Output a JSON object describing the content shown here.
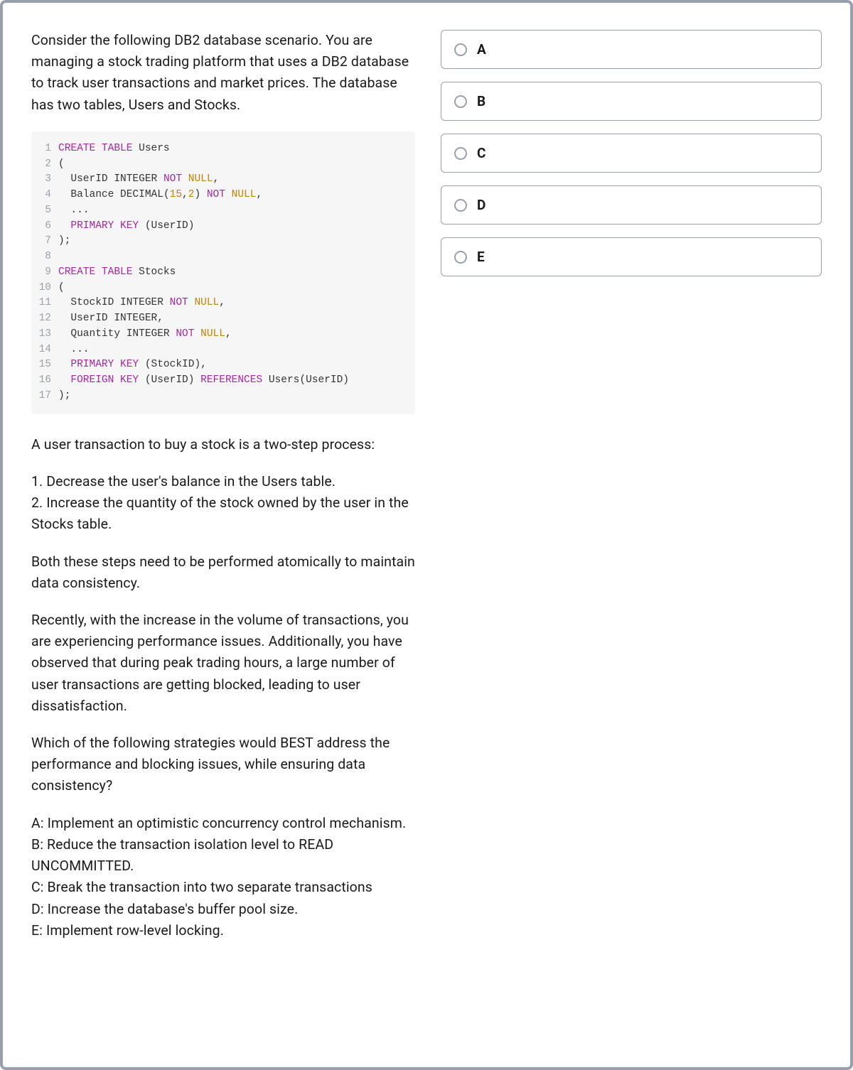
{
  "question": {
    "intro": "Consider the following DB2 database scenario. You are managing a stock trading platform that uses a DB2 database to track user transactions and market prices. The database has two tables, Users and Stocks.",
    "after_code_1": "A user transaction to buy a stock is a two-step process:",
    "steps": "1. Decrease the user's balance in the Users table.\n2. Increase the quantity of the stock owned by the user in the Stocks table.",
    "atomic": "Both these steps need to be performed atomically to maintain data consistency.",
    "problem": "Recently, with the increase in the volume of transactions, you are experiencing performance issues. Additionally, you have observed that during peak trading hours, a large number of user transactions are getting blocked, leading to user dissatisfaction.",
    "ask": "Which of the following strategies would BEST address the performance and blocking issues, while ensuring data consistency?",
    "choices_text": "A: Implement an optimistic concurrency control mechanism.\nB: Reduce the transaction isolation level to READ UNCOMMITTED.\nC: Break the transaction into two separate transactions\nD: Increase the database's buffer pool size.\nE: Implement row-level locking."
  },
  "code": {
    "lines": [
      [
        {
          "t": "CREATE TABLE",
          "c": "kw"
        },
        {
          "t": " Users",
          "c": ""
        }
      ],
      [
        {
          "t": "(",
          "c": ""
        }
      ],
      [
        {
          "t": "  UserID ",
          "c": ""
        },
        {
          "t": "INTEGER",
          "c": ""
        },
        {
          "t": " ",
          "c": ""
        },
        {
          "t": "NOT",
          "c": "kw"
        },
        {
          "t": " ",
          "c": ""
        },
        {
          "t": "NULL",
          "c": "null"
        },
        {
          "t": ",",
          "c": ""
        }
      ],
      [
        {
          "t": "  Balance ",
          "c": ""
        },
        {
          "t": "DECIMAL",
          "c": ""
        },
        {
          "t": "(",
          "c": ""
        },
        {
          "t": "15",
          "c": "num"
        },
        {
          "t": ",",
          "c": ""
        },
        {
          "t": "2",
          "c": "num"
        },
        {
          "t": ") ",
          "c": ""
        },
        {
          "t": "NOT",
          "c": "kw"
        },
        {
          "t": " ",
          "c": ""
        },
        {
          "t": "NULL",
          "c": "null"
        },
        {
          "t": ",",
          "c": ""
        }
      ],
      [
        {
          "t": "  ...",
          "c": ""
        }
      ],
      [
        {
          "t": "  ",
          "c": ""
        },
        {
          "t": "PRIMARY KEY",
          "c": "kw"
        },
        {
          "t": " (UserID)",
          "c": ""
        }
      ],
      [
        {
          "t": ");",
          "c": ""
        }
      ],
      [
        {
          "t": "",
          "c": ""
        }
      ],
      [
        {
          "t": "CREATE TABLE",
          "c": "kw"
        },
        {
          "t": " Stocks",
          "c": ""
        }
      ],
      [
        {
          "t": "(",
          "c": ""
        }
      ],
      [
        {
          "t": "  StockID ",
          "c": ""
        },
        {
          "t": "INTEGER",
          "c": ""
        },
        {
          "t": " ",
          "c": ""
        },
        {
          "t": "NOT",
          "c": "kw"
        },
        {
          "t": " ",
          "c": ""
        },
        {
          "t": "NULL",
          "c": "null"
        },
        {
          "t": ",",
          "c": ""
        }
      ],
      [
        {
          "t": "  UserID ",
          "c": ""
        },
        {
          "t": "INTEGER",
          "c": ""
        },
        {
          "t": ",",
          "c": ""
        }
      ],
      [
        {
          "t": "  Quantity ",
          "c": ""
        },
        {
          "t": "INTEGER",
          "c": ""
        },
        {
          "t": " ",
          "c": ""
        },
        {
          "t": "NOT",
          "c": "kw"
        },
        {
          "t": " ",
          "c": ""
        },
        {
          "t": "NULL",
          "c": "null"
        },
        {
          "t": ",",
          "c": ""
        }
      ],
      [
        {
          "t": "  ...",
          "c": ""
        }
      ],
      [
        {
          "t": "  ",
          "c": ""
        },
        {
          "t": "PRIMARY KEY",
          "c": "kw"
        },
        {
          "t": " (StockID),",
          "c": ""
        }
      ],
      [
        {
          "t": "  ",
          "c": ""
        },
        {
          "t": "FOREIGN KEY",
          "c": "kw"
        },
        {
          "t": " (UserID) ",
          "c": ""
        },
        {
          "t": "REFERENCES",
          "c": "kw"
        },
        {
          "t": " Users(UserID)",
          "c": ""
        }
      ],
      [
        {
          "t": ");",
          "c": ""
        }
      ]
    ]
  },
  "options": [
    {
      "label": "A"
    },
    {
      "label": "B"
    },
    {
      "label": "C"
    },
    {
      "label": "D"
    },
    {
      "label": "E"
    }
  ]
}
